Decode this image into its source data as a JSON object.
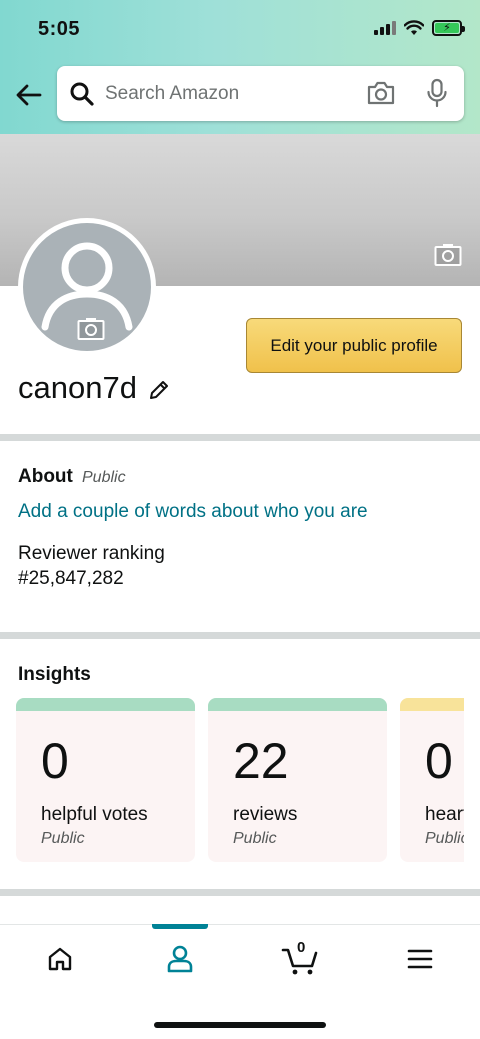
{
  "status_bar": {
    "time": "5:05",
    "battery_charging": true
  },
  "search": {
    "placeholder": "Search Amazon"
  },
  "profile": {
    "username": "canon7d",
    "edit_button": "Edit your public profile"
  },
  "about": {
    "title": "About",
    "visibility": "Public",
    "link": "Add a couple of words about who you are",
    "ranking_label": "Reviewer ranking",
    "ranking_value": "#25,847,282"
  },
  "insights": {
    "title": "Insights",
    "cards": [
      {
        "value": "0",
        "label": "helpful votes",
        "visibility": "Public",
        "accent": "#a8dcc2"
      },
      {
        "value": "22",
        "label": "reviews",
        "visibility": "Public",
        "accent": "#a8dcc2"
      },
      {
        "value": "0",
        "label": "hearts",
        "visibility": "Public",
        "accent": "#f8e39a"
      }
    ]
  },
  "bottom_nav": {
    "items": [
      {
        "icon": "home-icon",
        "active": false
      },
      {
        "icon": "profile-icon",
        "active": true
      },
      {
        "icon": "cart-icon",
        "active": false,
        "count": "0"
      },
      {
        "icon": "menu-icon",
        "active": false
      }
    ],
    "accent": "#008296"
  },
  "colors": {
    "link": "#007185",
    "button": "#f0c14b"
  }
}
